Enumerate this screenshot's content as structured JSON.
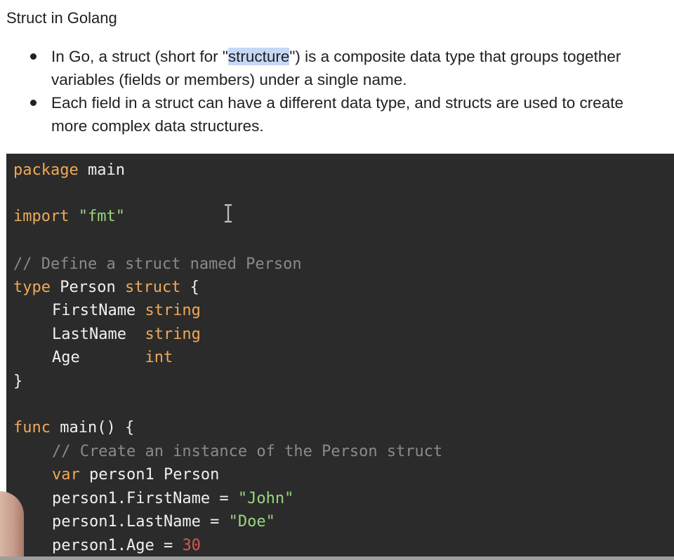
{
  "doc": {
    "title": "Struct in Golang",
    "bullets": [
      {
        "before": "In Go, a struct (short for \"",
        "highlight": "structure",
        "after": "\") is a composite data type that groups together variables (fields or members) under a single name."
      },
      {
        "text": "Each field in a struct can have a different data type, and structs are used to create more complex data structures."
      }
    ]
  },
  "code": {
    "l1": {
      "kw": "package",
      "id": " main"
    },
    "l2": {
      "kw": "import",
      "sp": " ",
      "str": "\"fmt\""
    },
    "l3": {
      "cm": "// Define a struct named Person"
    },
    "l4": {
      "kw1": "type",
      "id": " Person ",
      "kw2": "struct",
      "tail": " {"
    },
    "l5": {
      "id": "FirstName ",
      "kw": "string"
    },
    "l6": {
      "id": "LastName  ",
      "kw": "string"
    },
    "l7": {
      "id": "Age       ",
      "kw": "int"
    },
    "l8": {
      "tail": "}"
    },
    "l9": {
      "kw": "func",
      "id": " main",
      "tail": "() {"
    },
    "l10": {
      "cm": "// Create an instance of the Person struct"
    },
    "l11": {
      "kw": "var",
      "id": " person1 Person"
    },
    "l12": {
      "id": "person1.FirstName = ",
      "str": "\"John\""
    },
    "l13": {
      "id": "person1.LastName = ",
      "str": "\"Doe\""
    },
    "l14": {
      "id": "person1.Age = ",
      "num": "30"
    }
  },
  "colors": {
    "keyword": "#f0a956",
    "string": "#98d67e",
    "comment": "#8a8a8a",
    "number": "#e0544a",
    "panel_bg": "#2b2b2b",
    "selection": "#c5d8f5"
  },
  "icons": {
    "cursor": "text-cursor-icon"
  }
}
